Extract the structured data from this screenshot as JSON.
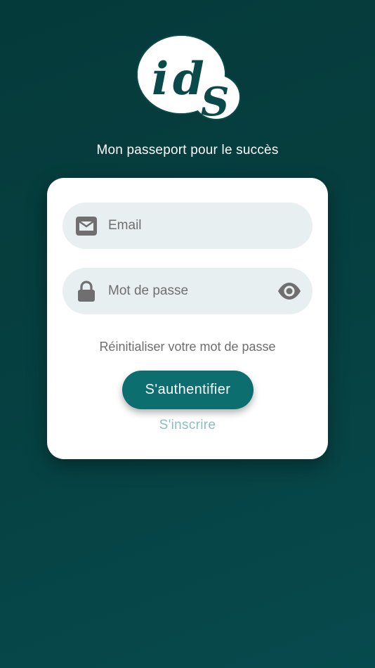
{
  "logo": {
    "text_i": "i",
    "text_d": "d",
    "text_s": "S",
    "colors": {
      "bubble": "#ffffff",
      "outline": "#0a4a4a",
      "text": "#0a4a4a"
    }
  },
  "tagline": "Mon passeport pour le succès",
  "login_form": {
    "email": {
      "placeholder": "Email",
      "value": "",
      "icon": "envelope-icon"
    },
    "password": {
      "placeholder": "Mot de passe",
      "value": "",
      "icon": "lock-icon",
      "toggle_icon": "eye-icon"
    },
    "reset_label": "Réinitialiser votre mot de passe",
    "submit_label": "S'authentifier",
    "signup_label": "S'inscrire"
  },
  "colors": {
    "background": "#063f40",
    "card": "#ffffff",
    "field_bg": "#e8eff0",
    "primary": "#0d6e70",
    "secondary_link": "#8bbfbf",
    "icon_grey": "#6f6f6f"
  }
}
